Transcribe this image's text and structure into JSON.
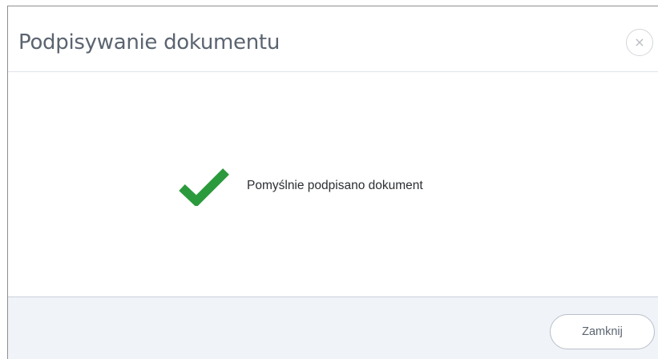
{
  "dialog": {
    "title": "Podpisywanie dokumentu",
    "close_icon": "close-icon",
    "close_glyph": "×",
    "message": "Pomyślnie podpisano dokument",
    "status_icon": "checkmark-icon",
    "close_button_label": "Zamknij"
  },
  "colors": {
    "success": "#2b9a3c",
    "title": "#5b6470",
    "footer_bg": "#f0f3f7"
  }
}
